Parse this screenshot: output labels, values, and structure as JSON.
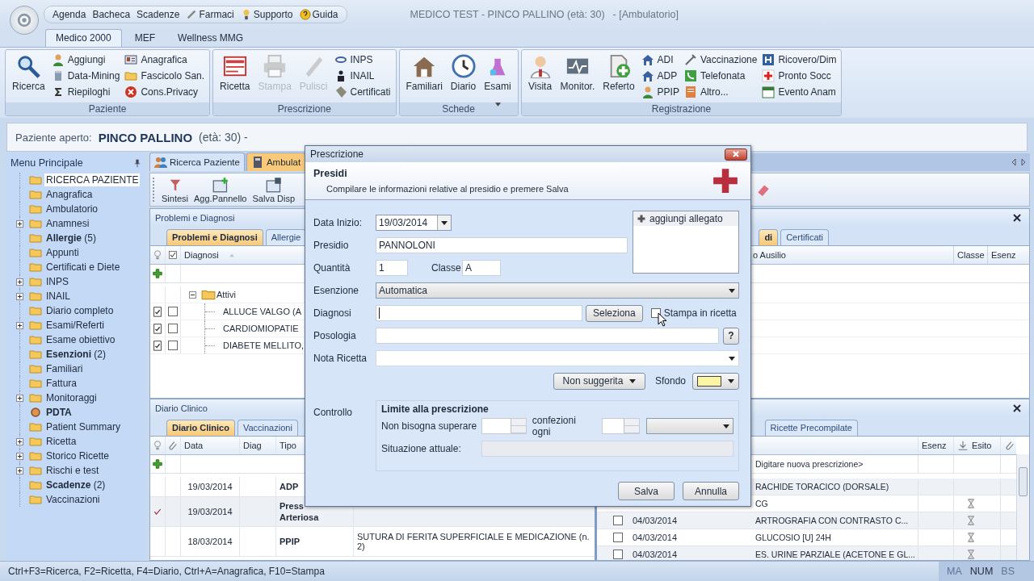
{
  "app": {
    "title": "MEDICO TEST - PINCO PALLINO (età: 30)",
    "context": "- [Ambulatorio]"
  },
  "quick_menu": [
    {
      "label": "Agenda",
      "kind": "plain"
    },
    {
      "label": "Bacheca",
      "kind": "plain"
    },
    {
      "label": "Scadenze",
      "kind": "plain"
    },
    {
      "label": "Farmaci",
      "kind": "icon"
    },
    {
      "label": "Supporto",
      "kind": "icon"
    },
    {
      "label": "Guida",
      "kind": "icon"
    }
  ],
  "ribbon": {
    "tabs": [
      {
        "label": "Medico 2000",
        "selected": true
      },
      {
        "label": "MEF",
        "selected": false
      },
      {
        "label": "Wellness MMG",
        "selected": false
      }
    ],
    "groups": [
      {
        "label": "Paziente",
        "columns": [
          {
            "kind": "large",
            "items": [
              {
                "label": "Ricerca",
                "disabled": false,
                "dropdown": false
              }
            ]
          },
          {
            "kind": "small",
            "items": [
              {
                "label": "Aggiungi",
                "disabled": false
              },
              {
                "label": "Data-Mining",
                "disabled": false
              },
              {
                "label": "Riepiloghi",
                "disabled": false
              }
            ]
          },
          {
            "kind": "small",
            "items": [
              {
                "label": "Anagrafica",
                "disabled": false
              },
              {
                "label": "Fascicolo San.",
                "disabled": false
              },
              {
                "label": "Cons.Privacy",
                "disabled": false
              }
            ]
          }
        ]
      },
      {
        "label": "Prescrizione",
        "columns": [
          {
            "kind": "large",
            "items": [
              {
                "label": "Ricetta",
                "disabled": false,
                "dropdown": false
              }
            ]
          },
          {
            "kind": "large",
            "items": [
              {
                "label": "Stampa",
                "disabled": true,
                "dropdown": false
              }
            ]
          },
          {
            "kind": "large",
            "items": [
              {
                "label": "Pulisci",
                "disabled": true,
                "dropdown": false
              }
            ]
          },
          {
            "kind": "small",
            "items": [
              {
                "label": "INPS",
                "disabled": false
              },
              {
                "label": "INAIL",
                "disabled": false
              },
              {
                "label": "Certificati",
                "disabled": false
              }
            ]
          }
        ]
      },
      {
        "label": "Schede",
        "columns": [
          {
            "kind": "large",
            "items": [
              {
                "label": "Familiari",
                "disabled": false,
                "dropdown": false
              }
            ]
          },
          {
            "kind": "large",
            "items": [
              {
                "label": "Diario",
                "disabled": false,
                "dropdown": false
              }
            ]
          },
          {
            "kind": "large",
            "items": [
              {
                "label": "Esami",
                "disabled": false,
                "dropdown": true
              }
            ]
          }
        ]
      },
      {
        "label": "Registrazione",
        "columns": [
          {
            "kind": "large",
            "items": [
              {
                "label": "Visita",
                "disabled": false,
                "dropdown": false
              }
            ]
          },
          {
            "kind": "large",
            "items": [
              {
                "label": "Monitor.",
                "disabled": false,
                "dropdown": false
              }
            ]
          },
          {
            "kind": "large",
            "items": [
              {
                "label": "Referto",
                "disabled": false,
                "dropdown": false
              }
            ]
          },
          {
            "kind": "small",
            "items": [
              {
                "label": "ADI",
                "disabled": false
              },
              {
                "label": "ADP",
                "disabled": false
              },
              {
                "label": "PPIP",
                "disabled": false
              }
            ]
          },
          {
            "kind": "small",
            "items": [
              {
                "label": "Vaccinazione",
                "disabled": false
              },
              {
                "label": "Telefonata",
                "disabled": false
              },
              {
                "label": "Altro...",
                "disabled": false
              }
            ]
          },
          {
            "kind": "small",
            "items": [
              {
                "label": "Ricovero/Dim",
                "disabled": false
              },
              {
                "label": "Pronto Socc",
                "disabled": false
              },
              {
                "label": "Evento Anam",
                "disabled": false
              }
            ]
          }
        ]
      }
    ]
  },
  "patient": {
    "label": "Paziente aperto:",
    "name": "PINCO PALLINO",
    "age": "(età: 30) -"
  },
  "sidebar": {
    "title": "Menu Principale",
    "items": [
      {
        "label": "RICERCA PAZIENTE",
        "kind": "folder",
        "expandable": false,
        "selected": true
      },
      {
        "label": "Anagrafica",
        "kind": "folder",
        "expandable": false,
        "selected": false
      },
      {
        "label": "Ambulatorio",
        "kind": "folder",
        "expandable": false,
        "selected": false
      },
      {
        "label": "Anamnesi",
        "kind": "folder",
        "expandable": true,
        "selected": false
      },
      {
        "label": "**Allergie** (5)",
        "kind": "folder",
        "expandable": false,
        "selected": false
      },
      {
        "label": "Appunti",
        "kind": "folder",
        "expandable": false,
        "selected": false
      },
      {
        "label": "Certificati e Diete",
        "kind": "folder",
        "expandable": false,
        "selected": false
      },
      {
        "label": "INPS",
        "kind": "folder",
        "expandable": true,
        "selected": false
      },
      {
        "label": "INAIL",
        "kind": "folder",
        "expandable": true,
        "selected": false
      },
      {
        "label": "Diario completo",
        "kind": "folder",
        "expandable": false,
        "selected": false
      },
      {
        "label": "Esami/Referti",
        "kind": "folder",
        "expandable": true,
        "selected": false
      },
      {
        "label": "Esame obiettivo",
        "kind": "folder",
        "expandable": false,
        "selected": false
      },
      {
        "label": "**Esenzioni** (2)",
        "kind": "folder",
        "expandable": false,
        "selected": false
      },
      {
        "label": "Familiari",
        "kind": "folder",
        "expandable": false,
        "selected": false
      },
      {
        "label": "Fattura",
        "kind": "folder",
        "expandable": false,
        "selected": false
      },
      {
        "label": "Monitoraggi",
        "kind": "folder",
        "expandable": true,
        "selected": false
      },
      {
        "label": "PDTA",
        "kind": "module",
        "expandable": false,
        "selected": false
      },
      {
        "label": "Patient Summary",
        "kind": "folder",
        "expandable": false,
        "selected": false
      },
      {
        "label": "Ricetta",
        "kind": "folder",
        "expandable": true,
        "selected": false
      },
      {
        "label": "Storico Ricette",
        "kind": "folder",
        "expandable": true,
        "selected": false
      },
      {
        "label": "Rischi e test",
        "kind": "folder",
        "expandable": true,
        "selected": false
      },
      {
        "label": "**Scadenze** (2)",
        "kind": "folder",
        "expandable": false,
        "selected": false
      },
      {
        "label": "Vaccinazioni",
        "kind": "folder",
        "expandable": false,
        "selected": false
      }
    ]
  },
  "main_tabs": [
    {
      "label": "Ricerca Paziente",
      "selected": false
    },
    {
      "label": "Ambulat",
      "selected": true
    }
  ],
  "toolbar": [
    "Sintesi",
    "Agg.Pannello",
    "Salva Disp"
  ],
  "problems": {
    "title": "Problemi e Diagnosi",
    "tabs": [
      {
        "label": "Problemi e Diagnosi",
        "selected": true
      },
      {
        "label": "Allergie",
        "selected": false
      }
    ],
    "tabs_right": [
      {
        "label": "di",
        "selected": true
      },
      {
        "label": "Certificati",
        "selected": false
      }
    ],
    "columns": [
      "Diagnosi",
      "o Ausilio",
      "Classe",
      "Esenz"
    ],
    "group": {
      "label": "Attivi",
      "expanded": true,
      "rows": [
        {
          "text": "ALLUCE VALGO (A",
          "flag": true,
          "checked": false
        },
        {
          "text": "CARDIOMIOPATIE",
          "flag": true,
          "checked": false
        },
        {
          "text": "DIABETE MELLITO,",
          "flag": true,
          "checked": false
        }
      ]
    }
  },
  "diary": {
    "title": "Diario Clinico",
    "tabs": [
      {
        "label": "Diario Clinico",
        "selected": true
      },
      {
        "label": "Vaccinazioni",
        "selected": false
      }
    ],
    "tabs_right": [
      {
        "label": "Ricette Precompilate",
        "selected": false
      }
    ],
    "columns": [
      "Data",
      "Diag",
      "Tipo"
    ],
    "rows": [
      {
        "done": false,
        "selected": false,
        "date": "19/03/2014",
        "type": "ADP"
      },
      {
        "done": true,
        "selected": true,
        "date": "19/03/2014",
        "type": "Press\nArteriosa"
      },
      {
        "done": false,
        "selected": false,
        "date": "18/03/2014",
        "type": "PPIP",
        "description": "SUTURA DI FERITA SUPERFICIALE E MEDICAZIONE (n. 2)"
      }
    ]
  },
  "prescriptions": {
    "columns": [
      "Esenz",
      "Esito"
    ],
    "new_row": "Digitare nuova prescrizione>",
    "rows": [
      {
        "kind": "clipped",
        "description": "RACHIDE TORACICO (DORSALE)",
        "pending": false
      },
      {
        "kind": "clipped",
        "description": "CG",
        "pending": true
      },
      {
        "kind": "full",
        "checked": false,
        "date": "04/03/2014",
        "description": "ARTROGRAFIA CON CONTRASTO C...",
        "pending": true
      },
      {
        "kind": "full",
        "checked": false,
        "date": "04/03/2014",
        "description": "GLUCOSIO [U] 24H",
        "pending": true
      },
      {
        "kind": "full",
        "checked": false,
        "date": "04/03/2014",
        "description": "ES. URINE PARZIALE (ACETONE E GL...",
        "pending": true
      }
    ]
  },
  "status_bar": {
    "shortcuts": "Ctrl+F3=Ricerca, F2=Ricetta, F4=Diario, Ctrl+A=Anagrafica, F10=Stampa",
    "indicators": [
      {
        "label": "MA",
        "on": false
      },
      {
        "label": "NUM",
        "on": true
      },
      {
        "label": "BS",
        "on": false
      }
    ]
  },
  "dialog": {
    "title": "Prescrizione",
    "heading": "Presidi",
    "description": "Compilare le informazioni relative al presidio e premere Salva",
    "start_date": {
      "label": "Data Inizio:",
      "value": "19/03/2014"
    },
    "presidio": {
      "label": "Presidio",
      "value": "PANNOLONI"
    },
    "quantity": {
      "label": "Quantità",
      "value": "1"
    },
    "class": {
      "label": "Classe",
      "value": "A"
    },
    "exemption": {
      "label": "Esenzione",
      "value": "Automatica"
    },
    "diagnosis": {
      "label": "Diagnosi",
      "button": "Seleziona",
      "print_label": "Stampa in ricetta",
      "print_checked": false
    },
    "posology": {
      "label": "Posologia",
      "help": "?"
    },
    "note": {
      "label": "Nota Ricetta"
    },
    "suggestion": "Non suggerita",
    "background": {
      "label": "Sfondo",
      "color": "#fbf6a6"
    },
    "control": {
      "label": "Controllo",
      "title": "Limite alla prescrizione",
      "max_label": "Non bisogna superare",
      "every_label": "confezioni ogni",
      "current_label": "Situazione attuale:"
    },
    "attachment": "aggiungi allegato",
    "buttons": [
      "Salva",
      "Annulla"
    ]
  }
}
